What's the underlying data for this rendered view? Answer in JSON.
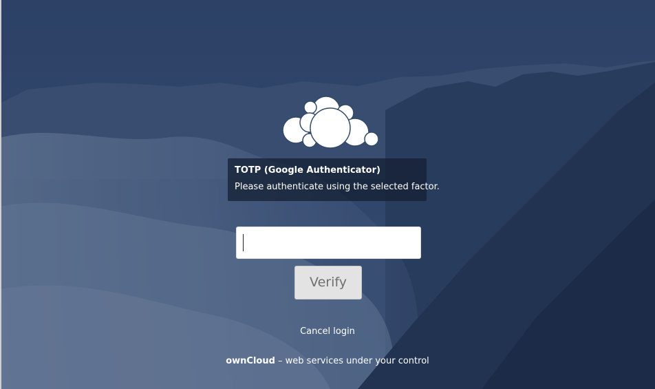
{
  "colors": {
    "background_base": "#33496a",
    "background_dark": "#1c2b44",
    "input_background": "#ffffff",
    "button_background": "#e3e3e3",
    "button_text": "#6f6f6f"
  },
  "logo": {
    "icon": "owncloud-cloud-logo"
  },
  "challenge": {
    "title": "TOTP (Google Authenticator)",
    "description": "Please authenticate using the selected factor."
  },
  "form": {
    "code_value": "",
    "code_placeholder": "",
    "verify_label": "Verify"
  },
  "cancel": {
    "label": "Cancel login"
  },
  "footer": {
    "brand": "ownCloud",
    "tagline": " – web services under your control"
  }
}
